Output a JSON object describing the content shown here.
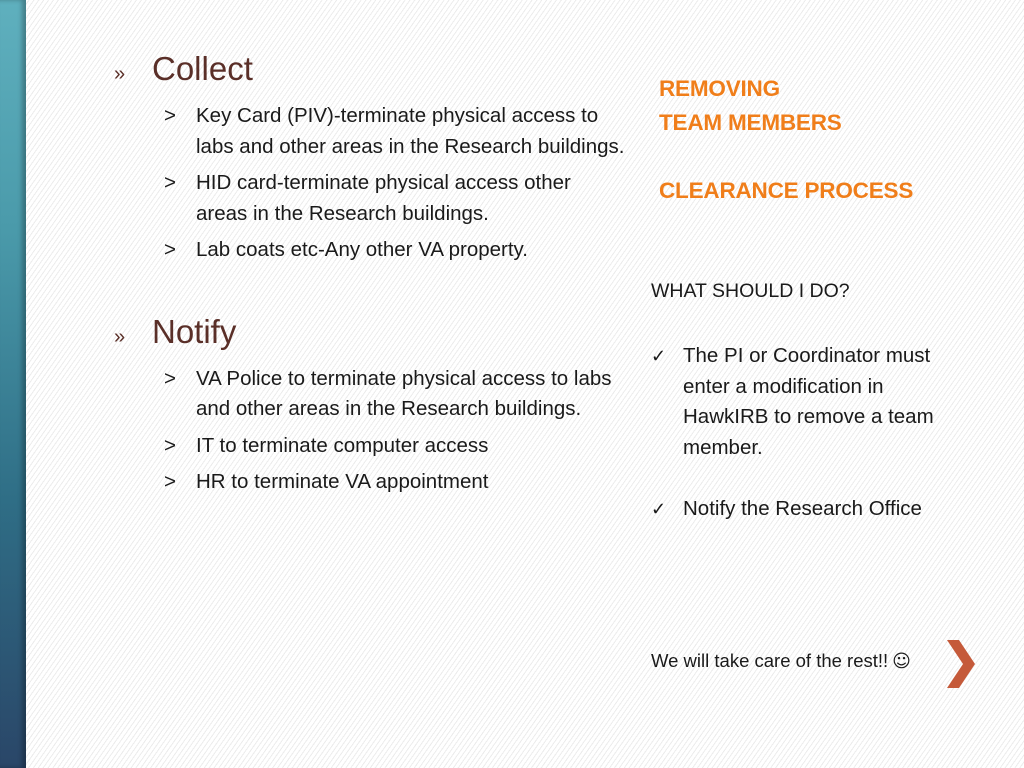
{
  "left": {
    "sections": [
      {
        "bullet": "»",
        "title": "Collect",
        "items": [
          {
            "marker": ">",
            "text": "Key Card (PIV)-terminate physical access to labs and other areas in the Research buildings."
          },
          {
            "marker": ">",
            "text": "HID card-terminate physical access other areas in the Research buildings."
          },
          {
            "marker": ">",
            "text": "Lab coats etc-Any other VA property."
          }
        ]
      },
      {
        "bullet": "»",
        "title": "Notify",
        "items": [
          {
            "marker": ">",
            "text": "VA Police to terminate physical access to labs and other areas in the Research buildings."
          },
          {
            "marker": ">",
            "text": "IT to terminate computer access"
          },
          {
            "marker": ">",
            "text": "HR to terminate VA appointment"
          }
        ]
      }
    ]
  },
  "right": {
    "title_line1": "REMOVING",
    "title_line2": "TEAM MEMBERS",
    "subtitle": "CLEARANCE PROCESS",
    "question": "WHAT SHOULD I DO?",
    "checklist": [
      {
        "icon": "✓",
        "text": "The PI or Coordinator must enter a modification in HawkIRB to remove a team member."
      },
      {
        "icon": "✓",
        "text": "Notify the Research Office"
      }
    ],
    "closing": "We will take care of the rest!!",
    "smiley": "☺"
  },
  "colors": {
    "heading_orange": "#f07e1a",
    "section_brown": "#5a2f28",
    "chevron_rust": "#c55a3a",
    "sidebar_teal": "#4a9aaa"
  }
}
